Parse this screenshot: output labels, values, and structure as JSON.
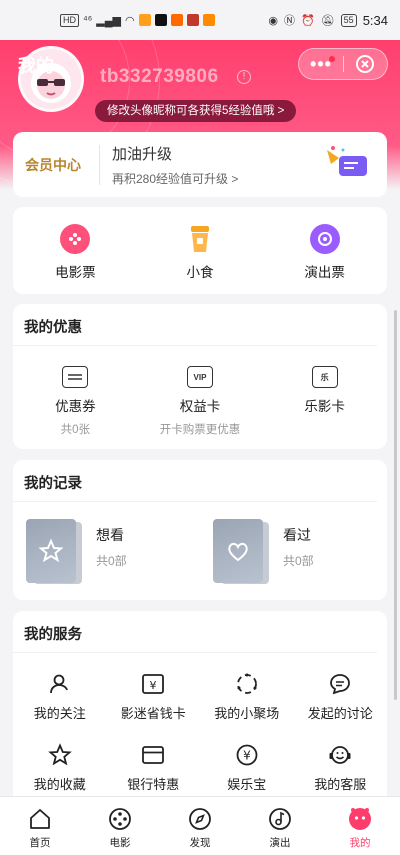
{
  "status_bar": {
    "hd": "HD",
    "network": "⁴⁶",
    "battery": "55",
    "time": "5:34"
  },
  "header": {
    "title": "我的",
    "username": "tb332739806",
    "promo": "修改头像昵称可各获得5经验值哦 >"
  },
  "member": {
    "label": "会员中心",
    "title": "加油升级",
    "subtitle": "再积280经验值可升级 >"
  },
  "tickets": [
    {
      "label": "电影票",
      "icon": "movie-reel-icon",
      "color": "#ff4f7b"
    },
    {
      "label": "小食",
      "icon": "snack-cup-icon",
      "color": "#f5a623"
    },
    {
      "label": "演出票",
      "icon": "music-disc-icon",
      "color": "#9b5cff"
    }
  ],
  "benefits": {
    "title": "我的优惠",
    "items": [
      {
        "label": "优惠券",
        "sub": "共0张",
        "icon": "coupon-icon"
      },
      {
        "label": "权益卡",
        "sub": "开卡购票更优惠",
        "icon": "vip-card-icon",
        "badge": "VIP"
      },
      {
        "label": "乐影卡",
        "sub": "",
        "icon": "film-card-icon",
        "badge": "乐"
      }
    ]
  },
  "records": {
    "title": "我的记录",
    "items": [
      {
        "label": "想看",
        "sub": "共0部",
        "icon": "star-icon"
      },
      {
        "label": "看过",
        "sub": "共0部",
        "icon": "heart-icon"
      }
    ]
  },
  "services": {
    "title": "我的服务",
    "items": [
      {
        "label": "我的关注",
        "icon": "follow-user-icon"
      },
      {
        "label": "影迷省钱卡",
        "icon": "yen-card-icon"
      },
      {
        "label": "我的小聚场",
        "icon": "gathering-icon"
      },
      {
        "label": "发起的讨论",
        "icon": "discussion-icon"
      },
      {
        "label": "我的收藏",
        "icon": "star-outline-icon"
      },
      {
        "label": "银行特惠",
        "icon": "bank-card-icon"
      },
      {
        "label": "娱乐宝",
        "icon": "yen-circle-icon"
      },
      {
        "label": "我的客服",
        "icon": "customer-service-icon"
      }
    ]
  },
  "tabs": [
    {
      "label": "首页",
      "icon": "home-icon"
    },
    {
      "label": "电影",
      "icon": "film-reel-icon"
    },
    {
      "label": "发现",
      "icon": "compass-icon"
    },
    {
      "label": "演出",
      "icon": "music-note-icon"
    },
    {
      "label": "我的",
      "icon": "profile-icon",
      "active": true
    }
  ],
  "accent_color": "#ff3d6c"
}
